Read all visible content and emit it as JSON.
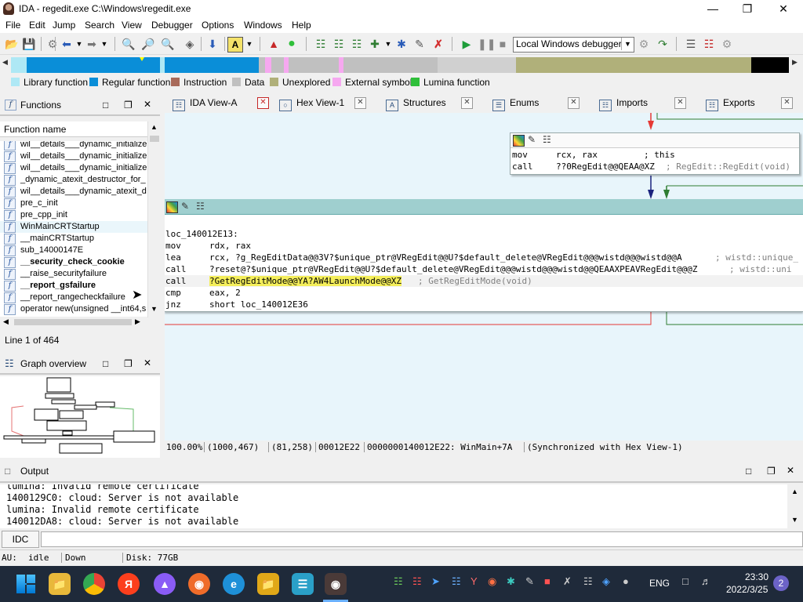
{
  "window": {
    "title": "IDA - regedit.exe C:\\Windows\\regedit.exe"
  },
  "menu": [
    "File",
    "Edit",
    "Jump",
    "Search",
    "View",
    "Debugger",
    "Options",
    "Windows",
    "Help"
  ],
  "toolbar": {
    "debugger_select": "Local Windows debugger"
  },
  "legend": [
    {
      "label": "Library function",
      "color": "#aee8f5"
    },
    {
      "label": "Regular function",
      "color": "#0a8ed8"
    },
    {
      "label": "Instruction",
      "color": "#a86a5a"
    },
    {
      "label": "Data",
      "color": "#c0c0c0"
    },
    {
      "label": "Unexplored",
      "color": "#b0b07a"
    },
    {
      "label": "External symbol",
      "color": "#f6a8f0"
    },
    {
      "label": "Lumina function",
      "color": "#2fbf3a"
    }
  ],
  "functions_pane": {
    "title": "Functions",
    "column_header": "Function name",
    "items": [
      {
        "name": "wil__details___dynamic_initializer",
        "bold": false
      },
      {
        "name": "wil__details___dynamic_initializer",
        "bold": false
      },
      {
        "name": "wil__details___dynamic_initializer",
        "bold": false
      },
      {
        "name": "_dynamic_atexit_destructor_for_",
        "bold": false
      },
      {
        "name": "wil__details___dynamic_atexit_d",
        "bold": false
      },
      {
        "name": "pre_c_init",
        "bold": false
      },
      {
        "name": "pre_cpp_init",
        "bold": false
      },
      {
        "name": "WinMainCRTStartup",
        "bold": false
      },
      {
        "name": "__mainCRTStartup",
        "bold": false
      },
      {
        "name": "sub_14000147E",
        "bold": false
      },
      {
        "name": "__security_check_cookie",
        "bold": true
      },
      {
        "name": "__raise_securityfailure",
        "bold": false
      },
      {
        "name": "__report_gsfailure",
        "bold": true
      },
      {
        "name": "__report_rangecheckfailure",
        "bold": false
      },
      {
        "name": "operator new(unsigned __int64,s",
        "bold": false
      }
    ],
    "line_info": "Line 1 of 464"
  },
  "graph_overview": {
    "title": "Graph overview"
  },
  "tabs": [
    {
      "label": "IDA View-A",
      "active": true
    },
    {
      "label": "Hex View-1",
      "active": false
    },
    {
      "label": "Structures",
      "active": false
    },
    {
      "label": "Enums",
      "active": false
    },
    {
      "label": "Imports",
      "active": false
    },
    {
      "label": "Exports",
      "active": false
    }
  ],
  "graph": {
    "top_block": [
      {
        "mnem": "mov",
        "ops": "rcx, rax",
        "comment": "; this"
      },
      {
        "mnem": "call",
        "ops": "??0RegEdit@@QEAA@XZ",
        "comment": "; RegEdit::RegEdit(void)"
      }
    ],
    "main_block": {
      "label": "loc_140012E13:",
      "lines": [
        {
          "mnem": "mov",
          "ops": "rdx, rax",
          "comment": ""
        },
        {
          "mnem": "lea",
          "ops": "rcx, ?g_RegEditData@@3V?$unique_ptr@VRegEdit@@U?$default_delete@VRegEdit@@@wistd@@@wistd@@A",
          "comment": "; wistd::unique_"
        },
        {
          "mnem": "call",
          "ops": "?reset@?$unique_ptr@VRegEdit@@U?$default_delete@VRegEdit@@@wistd@@@wistd@@QEAAXPEAVRegEdit@@@Z",
          "comment": "; wistd::uni"
        },
        {
          "mnem": "call",
          "ops": "?GetRegEditMode@@YA?AW4LaunchMode@@XZ",
          "comment": "; GetRegEditMode(void)"
        },
        {
          "mnem": "cmp",
          "ops": "eax, 2",
          "comment": ""
        },
        {
          "mnem": "jnz",
          "ops": "short loc_140012E36",
          "comment": ""
        }
      ]
    },
    "status": [
      "100.00%",
      "(1000,467)",
      "(81,258)",
      "00012E22",
      "0000000140012E22: WinMain+7A",
      "(Synchronized with Hex View-1)"
    ]
  },
  "output": {
    "title": "Output",
    "lines": [
      "lumina: Invalid remote certificate",
      "1400129C0: cloud: Server is not available",
      "lumina: Invalid remote certificate",
      "140012DA8: cloud: Server is not available"
    ],
    "idc_label": "IDC"
  },
  "statusbar": {
    "au": "AU:",
    "state": "idle",
    "direction": "Down",
    "disk": "Disk: 77GB"
  },
  "taskbar": {
    "lang": "ENG",
    "time": "23:30",
    "date": "2022/3/25",
    "notif": "2"
  }
}
